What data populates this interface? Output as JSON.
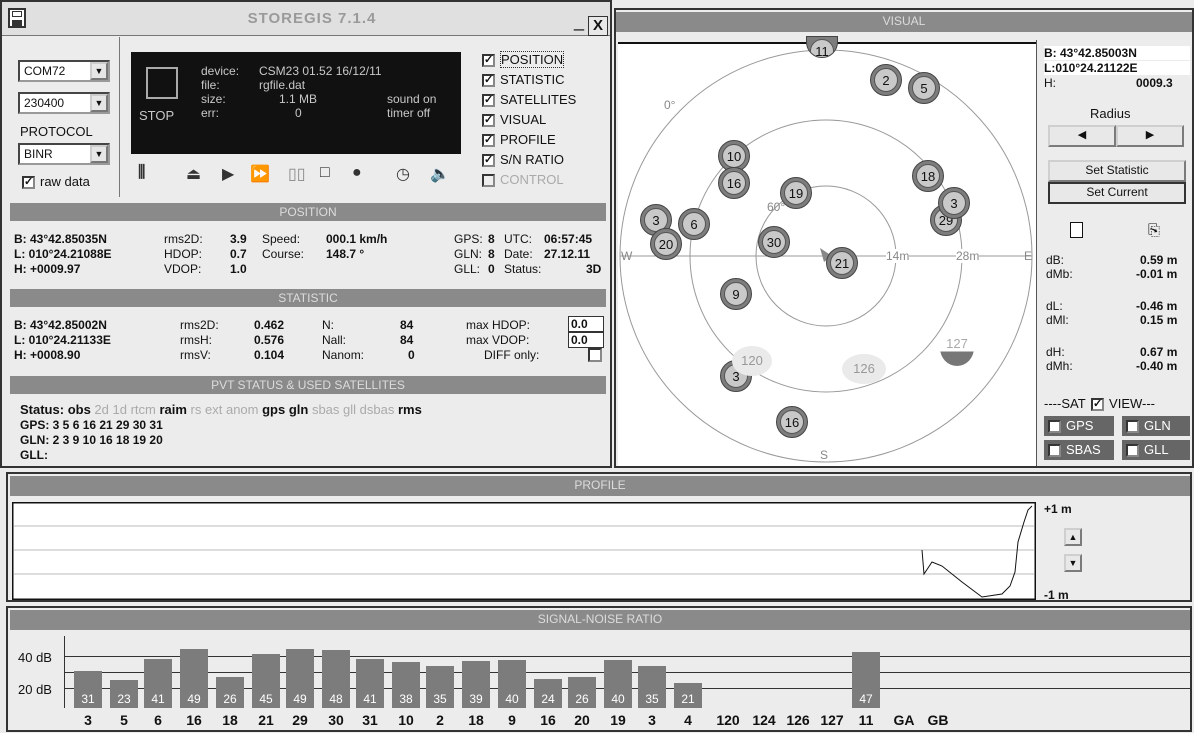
{
  "app": {
    "title": "STOREGIS 7.1.4",
    "minimize": "_",
    "close": "X"
  },
  "controls": {
    "port": "COM72",
    "baud": "230400",
    "protocol_label": "PROTOCOL",
    "protocol": "BINR",
    "raw_data": "raw data",
    "stop_label": "STOP"
  },
  "device": {
    "device_label": "device:",
    "device": "CSM23 01.52 16/12/11",
    "file_label": "file:",
    "file": "rgfile.dat",
    "size_label": "size:",
    "size": "1.1 MB",
    "sound": "sound on",
    "err_label": "err:",
    "err": "0",
    "timer": "timer off"
  },
  "toolbar": {
    "icons": [
      "bars-icon",
      "eject-icon",
      "play-icon",
      "fast-forward-icon",
      "pause-icon",
      "stop-square-icon",
      "record-icon",
      "clock-icon",
      "speaker-icon"
    ]
  },
  "views": {
    "items": [
      {
        "label": "POSITION",
        "checked": true
      },
      {
        "label": "STATISTIC",
        "checked": true
      },
      {
        "label": "SATELLITES",
        "checked": true
      },
      {
        "label": "VISUAL",
        "checked": true
      },
      {
        "label": "PROFILE",
        "checked": true
      },
      {
        "label": "S/N RATIO",
        "checked": true
      },
      {
        "label": "CONTROL",
        "checked": false
      }
    ]
  },
  "position": {
    "header": "POSITION",
    "b": "B:  43°42.85035N",
    "l": "L: 010°24.21088E",
    "h": "H:  +0009.97",
    "rms2d_l": "rms2D:",
    "rms2d": "3.9",
    "hdop_l": "HDOP:",
    "hdop": "0.7",
    "vdop_l": "VDOP:",
    "vdop": "1.0",
    "speed_l": "Speed:",
    "speed": "000.1 km/h",
    "course_l": "Course:",
    "course": "148.7 °",
    "gps_l": "GPS:",
    "gps": "8",
    "gln_l": "GLN:",
    "gln": "8",
    "gll_l": "GLL:",
    "gll": "0",
    "utc_l": "UTC:",
    "utc": "06:57:45",
    "date_l": "Date:",
    "date": "27.12.11",
    "status_l": "Status:",
    "status": "3D"
  },
  "statistic": {
    "header": "STATISTIC",
    "b": "B:  43°42.85002N",
    "l": "L: 010°24.21133E",
    "h": "H:  +0008.90",
    "rms2d_l": "rms2D:",
    "rms2d": "0.462",
    "rmsh_l": "rmsH:",
    "rmsh": "0.576",
    "rmsv_l": "rmsV:",
    "rmsv": "0.104",
    "n_l": "N:",
    "n": "84",
    "nall_l": "Nall:",
    "nall": "84",
    "nanom_l": "Nanom:",
    "nanom": "0",
    "maxh_l": "max HDOP:",
    "maxh": "0.0",
    "maxv_l": "max VDOP:",
    "maxv": "0.0",
    "diff_l": "DIFF only:"
  },
  "pvt": {
    "header": "PVT STATUS & USED SATELLITES",
    "status_label": "Status:",
    "flags": [
      {
        "t": "obs",
        "on": true
      },
      {
        "t": "2d",
        "on": false
      },
      {
        "t": "1d",
        "on": false
      },
      {
        "t": "rtcm",
        "on": false
      },
      {
        "t": "raim",
        "on": true
      },
      {
        "t": "rs",
        "on": false
      },
      {
        "t": "ext",
        "on": false
      },
      {
        "t": "anom",
        "on": false
      },
      {
        "t": "gps",
        "on": true
      },
      {
        "t": "gln",
        "on": true
      },
      {
        "t": "sbas",
        "on": false
      },
      {
        "t": "gll",
        "on": false
      },
      {
        "t": "dsbas",
        "on": false
      },
      {
        "t": "rms",
        "on": true
      }
    ],
    "gps": "GPS:  3 5 6 16 21 29 30 31",
    "gln": "GLN:  2 3 9 10 16 18 19 20",
    "gll": "GLL:"
  },
  "visual": {
    "header": "VISUAL",
    "zero": "0°",
    "sixty": "60°",
    "w": "W",
    "e": "E",
    "s": "S",
    "r14": "14m",
    "r28": "28m",
    "b": "B: 43°42.85003N",
    "l": "L:010°24.21122E",
    "h_label": "H:",
    "h": "0009.3",
    "radius": "Radius",
    "set_statistic": "Set Statistic",
    "set_current": "Set Current",
    "db_l": "dB:",
    "db": "0.59 m",
    "dmb_l": "dMb:",
    "dmb": "-0.01 m",
    "dl_l": "dL:",
    "dl": "-0.46 m",
    "dml_l": "dMl:",
    "dml": "0.15 m",
    "dh_l": "dH:",
    "dh": "0.67 m",
    "dmh_l": "dMh:",
    "dmh": "-0.40 m",
    "sat_view": "----SAT",
    "view_label": "VIEW---",
    "gps": "GPS",
    "gln": "GLN",
    "sbas": "SBAS",
    "gll": "GLL"
  },
  "profile": {
    "header": "PROFILE",
    "top": "+1 m",
    "bottom": "-1 m"
  },
  "snr": {
    "header": "SIGNAL-NOISE RATIO",
    "y40": "40 dB",
    "y20": "20 dB",
    "bars": [
      {
        "sat": "3",
        "v": 31
      },
      {
        "sat": "5",
        "v": 23
      },
      {
        "sat": "6",
        "v": 41
      },
      {
        "sat": "16",
        "v": 49
      },
      {
        "sat": "18",
        "v": 26
      },
      {
        "sat": "21",
        "v": 45
      },
      {
        "sat": "29",
        "v": 49
      },
      {
        "sat": "30",
        "v": 48
      },
      {
        "sat": "31",
        "v": 41
      },
      {
        "sat": "10",
        "v": 38
      },
      {
        "sat": "2",
        "v": 35
      },
      {
        "sat": "18",
        "v": 39
      },
      {
        "sat": "9",
        "v": 40
      },
      {
        "sat": "16",
        "v": 24
      },
      {
        "sat": "20",
        "v": 26
      },
      {
        "sat": "19",
        "v": 40
      },
      {
        "sat": "3",
        "v": 35
      },
      {
        "sat": "4",
        "v": 21
      },
      {
        "sat": "120",
        "v": null
      },
      {
        "sat": "124",
        "v": null
      },
      {
        "sat": "126",
        "v": null
      },
      {
        "sat": "127",
        "v": null
      },
      {
        "sat": "11",
        "v": 47
      },
      {
        "sat": "GA",
        "v": null
      },
      {
        "sat": "GB",
        "v": null
      }
    ]
  },
  "satellites": [
    {
      "id": "11"
    },
    {
      "id": "2"
    },
    {
      "id": "5"
    },
    {
      "id": "10"
    },
    {
      "id": "16"
    },
    {
      "id": "19"
    },
    {
      "id": "18"
    },
    {
      "id": "3"
    },
    {
      "id": "29"
    },
    {
      "id": "3"
    },
    {
      "id": "6"
    },
    {
      "id": "20"
    },
    {
      "id": "30"
    },
    {
      "id": "21"
    },
    {
      "id": "9"
    },
    {
      "id": "3"
    },
    {
      "id": "16"
    },
    {
      "id": "120"
    },
    {
      "id": "126"
    },
    {
      "id": "127"
    }
  ]
}
